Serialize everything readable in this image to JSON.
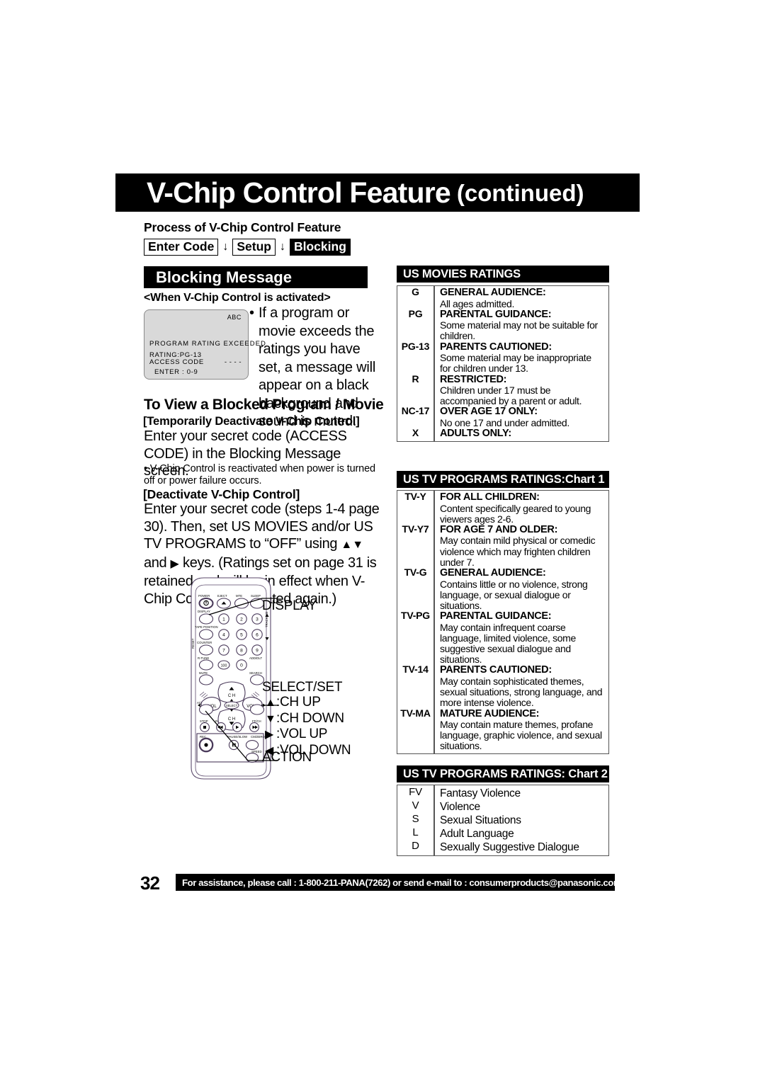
{
  "header": {
    "title_main": "V-Chip Control Feature",
    "title_suffix": "(continued)"
  },
  "process": {
    "label": "Process of V-Chip Control Feature",
    "steps": [
      "Enter Code",
      "Setup",
      "Blocking"
    ],
    "arrow": "↓"
  },
  "blocking": {
    "section_title": "Blocking Message",
    "subtitle": "<When V-Chip Control is activated>",
    "screen": {
      "abc": "ABC",
      "message": "PROGRAM RATING EXCEEDED",
      "rating": "RATING:PG-13",
      "access_code": "ACCESS CODE",
      "dashes": "- - - -",
      "enter": "ENTER  : 0-9"
    },
    "bullet": "If a program or movie exceeds the ratings you have set, a message will appear on a black background and sound is muted."
  },
  "view_blocked": {
    "heading": "To View a Blocked Program / Movie",
    "temp_heading": "[Temporarily Deactivate V-Chip Control]",
    "temp_body": "Enter your secret code (ACCESS CODE) in the Blocking Message screen.",
    "temp_note": "•  V-Chip Control is reactivated when power is turned off or power failure occurs.",
    "deact_heading": "[Deactivate V-Chip Control]",
    "deact_body_1": "Enter your secret code (steps 1-4 page 30). Then, set US MOVIES and/or US TV PROGRAMS to “OFF” using ",
    "deact_arrows_updown": "▲▼",
    "deact_body_2": " and ",
    "deact_arrow_right": "▶",
    "deact_body_3": " keys. (Ratings set on page 31 is retained and will be in effect when V-Chip Control is activated again.)"
  },
  "remote": {
    "labels": {
      "display": "DISPLAY",
      "select_set": "SELECT/SET",
      "ch_up": ":CH UP",
      "ch_down": ":CH DOWN",
      "vol_up": ":VOL UP",
      "vol_down": ":VOL DOWN",
      "action": "ACTION"
    },
    "buttons": {
      "power": "POWER",
      "eject": "EJECT",
      "mute_top": "MTE",
      "sleep": "SLEEP",
      "display": "DISPLAY",
      "tape_position": "TAPE POSITION",
      "counter": "COUNTER",
      "reset": "RESET",
      "r_tune": "R-TUNE",
      "add_dlt": "ADD/DLT",
      "mute": "MUTE",
      "search": "SEARCH",
      "tracking": "TRACKING",
      "ch": "CH",
      "vol_minus": "–VOL",
      "vol_plus": "VOL+",
      "select": "SELECT",
      "action": "ACTION",
      "prog": "PROG",
      "stop": "STOP",
      "rewind": "REW/CH",
      "play": "PLAY",
      "ff": "FF/CH",
      "rec": "REC",
      "pause_slow": "PAUSE/SLOW",
      "cm_zero": "CM/ZERO",
      "speed": "SPEED",
      "num_1": "1",
      "num_2": "2",
      "num_3": "3",
      "num_4": "4",
      "num_5": "5",
      "num_6": "6",
      "num_7": "7",
      "num_8": "8",
      "num_9": "9",
      "num_0": "0",
      "num_100": "100"
    }
  },
  "us_movies": {
    "section_title": "US MOVIES RATINGS",
    "rows": [
      {
        "code": "G",
        "title": "GENERAL AUDIENCE:",
        "body": "All ages admitted."
      },
      {
        "code": "PG",
        "title": "PARENTAL GUIDANCE:",
        "body": "Some material may not be suitable for children."
      },
      {
        "code": "PG-13",
        "title": "PARENTS CAUTIONED:",
        "body": "Some material may be inappropriate for children under 13."
      },
      {
        "code": "R",
        "title": "RESTRICTED:",
        "body": "Children under 17 must be accompanied by a parent or adult."
      },
      {
        "code": "NC-17",
        "title": "OVER AGE 17 ONLY:",
        "body": "No one 17 and under admitted."
      },
      {
        "code": "X",
        "title": "ADULTS ONLY:",
        "body": ""
      }
    ]
  },
  "us_tv_chart1": {
    "section_title": "US TV PROGRAMS RATINGS:Chart 1",
    "rows": [
      {
        "code": "TV-Y",
        "title": "FOR ALL CHILDREN:",
        "body": "Content specifically geared to young viewers ages 2-6."
      },
      {
        "code": "TV-Y7",
        "title": "FOR AGE 7 AND OLDER:",
        "body": "May contain mild physical or comedic violence which may frighten children under 7."
      },
      {
        "code": "TV-G",
        "title": "GENERAL AUDIENCE:",
        "body": "Contains little or no violence, strong language, or sexual dialogue or situations."
      },
      {
        "code": "TV-PG",
        "title": "PARENTAL GUIDANCE:",
        "body": "May contain infrequent coarse language, limited violence, some suggestive sexual dialogue and situations."
      },
      {
        "code": "TV-14",
        "title": "PARENTS CAUTIONED:",
        "body": "May contain sophisticated themes, sexual situations, strong language, and more intense violence."
      },
      {
        "code": "TV-MA",
        "title": "MATURE AUDIENCE:",
        "body": "May contain mature themes, profane language, graphic violence, and sexual situations."
      }
    ]
  },
  "us_tv_chart2": {
    "section_title": "US TV PROGRAMS RATINGS: Chart 2",
    "rows": [
      {
        "code": "FV",
        "body": "Fantasy Violence"
      },
      {
        "code": "V",
        "body": "Violence"
      },
      {
        "code": "S",
        "body": "Sexual Situations"
      },
      {
        "code": "L",
        "body": "Adult Language"
      },
      {
        "code": "D",
        "body": "Sexually Suggestive Dialogue"
      }
    ]
  },
  "footer": {
    "page_number": "32",
    "text": "For assistance, please call : 1-800-211-PANA(7262) or send e-mail to : consumerproducts@panasonic.com"
  },
  "colors": {
    "ink": "#000000",
    "paper": "#ffffff",
    "screen_gray": "#d9d9d9",
    "rule": "#555555"
  }
}
